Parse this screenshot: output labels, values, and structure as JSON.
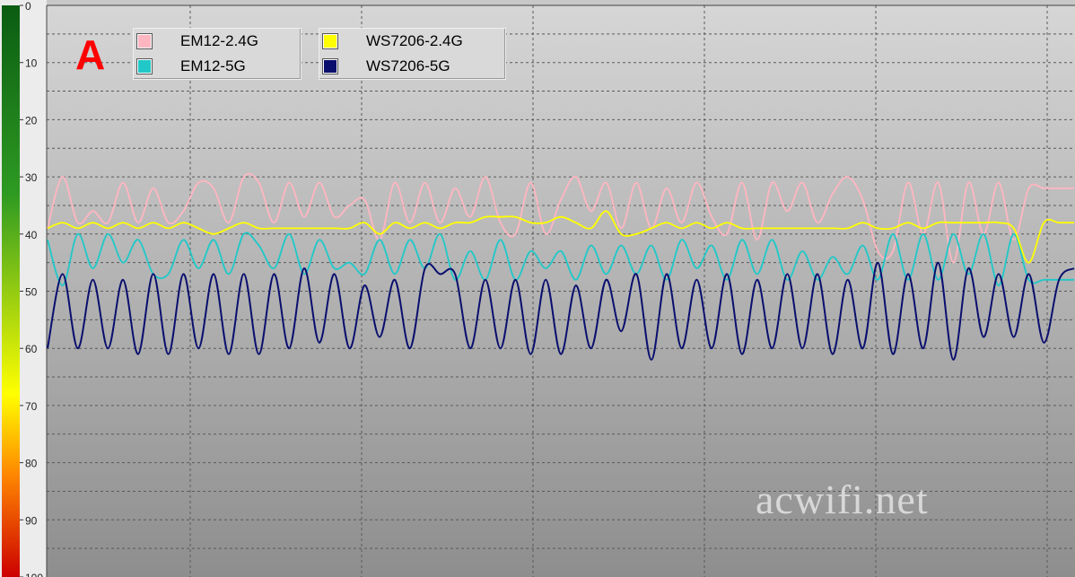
{
  "panel_label": "A",
  "watermark": "acwifi.net",
  "chart_data": {
    "type": "line",
    "title": "",
    "xlabel": "",
    "ylabel": "",
    "ylim": [
      0,
      100
    ],
    "y_inverted": true,
    "y_ticks": [
      "0",
      "10",
      "20",
      "30",
      "40",
      "50",
      "60",
      "70",
      "80",
      "90",
      "100"
    ],
    "grid": true,
    "legend_position": "top-left",
    "x_count": 93,
    "colors": {
      "background_top": "#d6d6d6",
      "background_bottom": "#8e8e8e",
      "scale_top": "#0a5c12",
      "scale_mid": "#ffff00",
      "scale_bottom": "#cc0000"
    },
    "series": [
      {
        "name": "EM12-2.4G",
        "color": "#ffb6c1",
        "values": [
          39,
          30,
          38,
          36,
          38,
          31,
          38,
          32,
          38,
          36,
          31,
          32,
          38,
          30,
          31,
          38,
          31,
          37,
          31,
          37,
          35,
          34,
          41,
          31,
          38,
          31,
          38,
          32,
          37,
          30,
          38,
          40,
          31,
          40,
          34,
          30,
          36,
          31,
          39,
          31,
          39,
          32,
          38,
          31,
          37,
          40,
          31,
          41,
          31,
          36,
          31,
          38,
          33,
          30,
          34,
          43,
          43,
          31,
          40,
          31,
          45,
          31,
          40,
          31,
          41,
          32,
          32,
          32,
          32
        ]
      },
      {
        "name": "EM12-5G",
        "color": "#20c8c8",
        "values": [
          41,
          49,
          40,
          46,
          40,
          45,
          41,
          47,
          47,
          41,
          46,
          41,
          47,
          40,
          42,
          46,
          40,
          47,
          41,
          46,
          45,
          47,
          41,
          47,
          41,
          46,
          40,
          48,
          43,
          48,
          41,
          48,
          43,
          46,
          43,
          48,
          42,
          47,
          42,
          47,
          42,
          48,
          41,
          46,
          42,
          48,
          41,
          47,
          41,
          48,
          43,
          48,
          44,
          47,
          42,
          48,
          40,
          48,
          40,
          48,
          40,
          47,
          40,
          49,
          40,
          48,
          48,
          48,
          48
        ]
      },
      {
        "name": "WS7206-2.4G",
        "color": "#ffff00",
        "values": [
          39,
          38,
          39,
          38,
          39,
          38,
          39,
          38,
          39,
          38,
          39,
          40,
          39,
          38,
          39,
          39,
          39,
          39,
          39,
          39,
          39,
          38,
          40,
          38,
          39,
          38,
          39,
          38,
          38,
          37,
          37,
          37,
          38,
          38,
          37,
          38,
          39,
          36,
          40,
          40,
          39,
          38,
          39,
          38,
          39,
          38,
          39,
          39,
          39,
          39,
          39,
          39,
          39,
          39,
          38,
          39,
          39,
          38,
          39,
          38,
          38,
          38,
          38,
          38,
          39,
          45,
          38,
          38,
          38
        ]
      },
      {
        "name": "WS7206-5G",
        "color": "#0a0f6e",
        "values": [
          60,
          47,
          60,
          48,
          60,
          48,
          61,
          47,
          61,
          47,
          60,
          47,
          61,
          47,
          61,
          47,
          60,
          46,
          59,
          47,
          60,
          49,
          58,
          48,
          60,
          46,
          47,
          47,
          60,
          48,
          60,
          48,
          61,
          48,
          61,
          49,
          60,
          48,
          57,
          47,
          62,
          47,
          60,
          48,
          60,
          47,
          61,
          48,
          60,
          47,
          60,
          47,
          61,
          48,
          60,
          45,
          61,
          47,
          60,
          45,
          62,
          46,
          58,
          47,
          58,
          47,
          59,
          48,
          46
        ]
      }
    ]
  }
}
